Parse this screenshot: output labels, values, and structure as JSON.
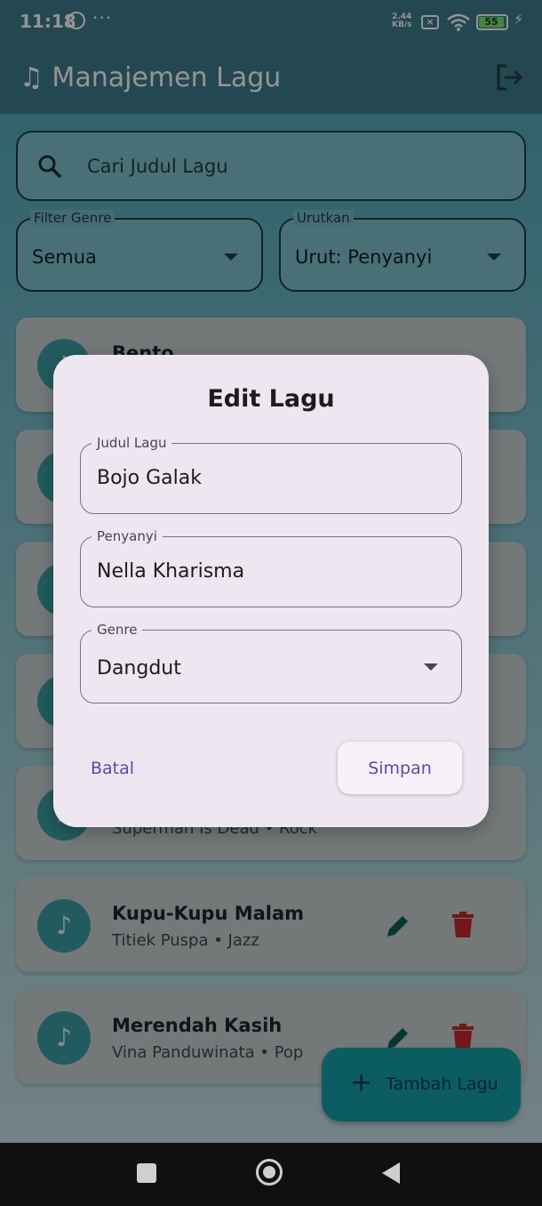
{
  "status": {
    "time": "11:18",
    "dots": "···",
    "speed_top": "2.44",
    "speed_bottom": "KB/s",
    "battery": "55"
  },
  "appbar": {
    "title": "♫ Manajemen Lagu"
  },
  "search": {
    "placeholder": "Cari Judul Lagu"
  },
  "filters": {
    "genre": {
      "label": "Filter Genre",
      "value": "Semua"
    },
    "sort": {
      "label": "Urutkan",
      "value": "Urut: Penyanyi"
    }
  },
  "songs": [
    {
      "title": "Bento",
      "subtitle": ""
    },
    {
      "title": "",
      "subtitle": ""
    },
    {
      "title": "",
      "subtitle": ""
    },
    {
      "title": "",
      "subtitle": ""
    },
    {
      "title": "",
      "subtitle": "Superman Is Dead  •  Rock"
    },
    {
      "title": "Kupu-Kupu Malam",
      "subtitle": "Titiek Puspa  •  Jazz"
    },
    {
      "title": "Merendah Kasih",
      "subtitle": "Vina Panduwinata  •  Pop"
    }
  ],
  "fab": {
    "label": "Tambah Lagu"
  },
  "dialog": {
    "title": "Edit Lagu",
    "fields": {
      "title": {
        "label": "Judul Lagu",
        "value": "Bojo Galak"
      },
      "artist": {
        "label": "Penyanyi",
        "value": "Nella Kharisma"
      },
      "genre": {
        "label": "Genre",
        "value": "Dangdut"
      }
    },
    "cancel": "Batal",
    "save": "Simpan"
  },
  "colors": {
    "primary": "#3d7c8c",
    "teal": "#13a0aa",
    "delete": "#c62828",
    "edit": "#0f5e50",
    "dialog_bg": "#eee6f1",
    "accent_text": "#5d4aa3"
  },
  "icons": [
    "whatsapp-icon",
    "wifi-icon",
    "battery-icon",
    "logout-icon",
    "search-icon",
    "music-note-icon",
    "edit-icon",
    "delete-icon",
    "plus-icon"
  ]
}
